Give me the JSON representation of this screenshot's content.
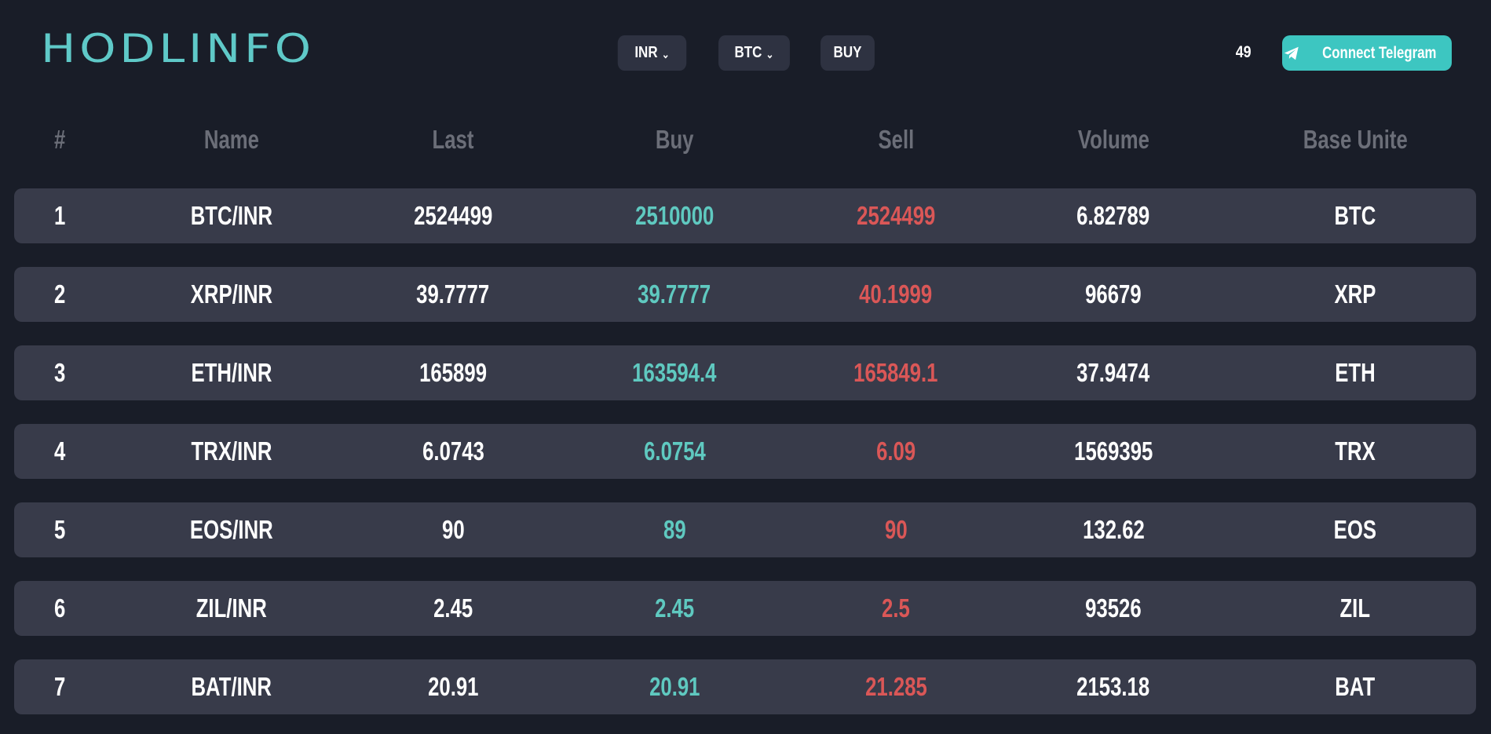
{
  "header": {
    "logo": "HODLINFO",
    "currency_label": "INR",
    "coin_label": "BTC",
    "buy_label": "BUY",
    "timer": "49",
    "telegram_label": "Connect Telegram"
  },
  "table": {
    "columns": [
      "#",
      "Name",
      "Last",
      "Buy",
      "Sell",
      "Volume",
      "Base Unite"
    ],
    "rows": [
      {
        "index": "1",
        "name": "BTC/INR",
        "last": "2524499",
        "buy": "2510000",
        "sell": "2524499",
        "volume": "6.82789",
        "base": "BTC"
      },
      {
        "index": "2",
        "name": "XRP/INR",
        "last": "39.7777",
        "buy": "39.7777",
        "sell": "40.1999",
        "volume": "96679",
        "base": "XRP"
      },
      {
        "index": "3",
        "name": "ETH/INR",
        "last": "165899",
        "buy": "163594.4",
        "sell": "165849.1",
        "volume": "37.9474",
        "base": "ETH"
      },
      {
        "index": "4",
        "name": "TRX/INR",
        "last": "6.0743",
        "buy": "6.0754",
        "sell": "6.09",
        "volume": "1569395",
        "base": "TRX"
      },
      {
        "index": "5",
        "name": "EOS/INR",
        "last": "90",
        "buy": "89",
        "sell": "90",
        "volume": "132.62",
        "base": "EOS"
      },
      {
        "index": "6",
        "name": "ZIL/INR",
        "last": "2.45",
        "buy": "2.45",
        "sell": "2.5",
        "volume": "93526",
        "base": "ZIL"
      },
      {
        "index": "7",
        "name": "BAT/INR",
        "last": "20.91",
        "buy": "20.91",
        "sell": "21.285",
        "volume": "2153.18",
        "base": "BAT"
      }
    ]
  },
  "colors": {
    "background": "#191d28",
    "row": "#383b4a",
    "accent": "#5fc9c8",
    "buy": "#5fc9c0",
    "sell": "#da5757"
  },
  "icons": {
    "telegram": "telegram-icon",
    "dropdown": "chevron-down-icon"
  }
}
